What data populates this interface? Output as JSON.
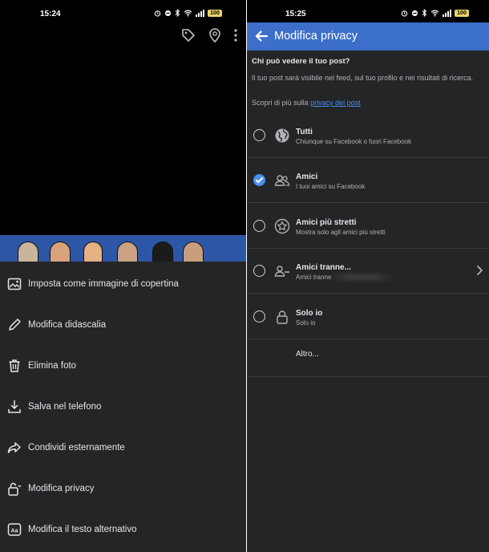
{
  "left": {
    "status": {
      "time": "15:24",
      "battery": "100"
    },
    "photo_actions": [
      {
        "name": "tag-icon"
      },
      {
        "name": "location-pin-icon"
      },
      {
        "name": "more-vertical-icon"
      }
    ],
    "menu": [
      {
        "label": "Imposta come immagine di copertina",
        "icon": "cover-image-icon"
      },
      {
        "label": "Modifica didascalia",
        "icon": "pencil-icon"
      },
      {
        "label": "Elimina foto",
        "icon": "trash-icon"
      },
      {
        "label": "Salva nel telefono",
        "icon": "download-icon"
      },
      {
        "label": "Condividi esternamente",
        "icon": "share-icon"
      },
      {
        "label": "Modifica privacy",
        "icon": "lock-icon"
      },
      {
        "label": "Modifica il testo alternativo",
        "icon": "alt-text-icon"
      }
    ]
  },
  "right": {
    "status": {
      "time": "15:25",
      "battery": "100"
    },
    "header": {
      "title": "Modifica privacy"
    },
    "intro": {
      "question": "Chi può vedere il tuo post?",
      "description": "Il tuo post sarà visibile nel feed,  sul tuo profilo e nei risultati di ricerca.",
      "learn_prefix": "Scopri di più sulla",
      "learn_link": "privacy dei post"
    },
    "options": [
      {
        "title": "Tutti",
        "subtitle": "Chiunque su Facebook o fuori Facebook",
        "icon": "globe-icon",
        "checked": false
      },
      {
        "title": "Amici",
        "subtitle": "I tuoi amici su Facebook",
        "icon": "friends-icon",
        "checked": true
      },
      {
        "title": "Amici più stretti",
        "subtitle": "Mostra solo agli amici più stretti",
        "icon": "star-icon",
        "checked": false
      },
      {
        "title": "Amici tranne...",
        "subtitle": "Amici tranne",
        "icon": "friends-except-icon",
        "checked": false
      },
      {
        "title": "Solo io",
        "subtitle": "Solo io",
        "icon": "lock-icon",
        "checked": false
      }
    ],
    "more": "Altro..."
  },
  "colors": {
    "accent": "#3b6fc9",
    "link": "#4a8ef0",
    "sheet": "#242526"
  }
}
